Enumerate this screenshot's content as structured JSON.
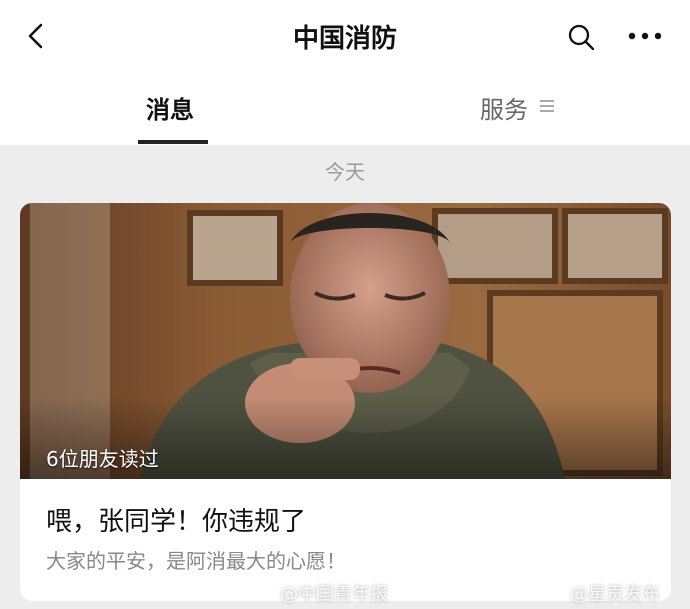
{
  "header": {
    "title": "中国消防",
    "icons": {
      "back": "chevron-left-icon",
      "search": "search-icon",
      "more": "more-horizontal-icon"
    }
  },
  "tabs": [
    {
      "label": "消息",
      "active": true
    },
    {
      "label": "服务",
      "active": false,
      "icon": "menu-lines-icon"
    }
  ],
  "feed": {
    "date_label": "今天",
    "article": {
      "read_count": "6位朋友读过",
      "headline": "喂，张同学！你违规了",
      "subtitle": "大家的平安，是阿消最大的心愿！"
    }
  },
  "watermarks": [
    "@中国青年报",
    "@星贡发布"
  ],
  "colors": {
    "header_bg": "#ffffff",
    "page_bg": "#ededed",
    "tab_active": "#111111",
    "tab_inactive": "#666666",
    "muted": "#888888"
  }
}
